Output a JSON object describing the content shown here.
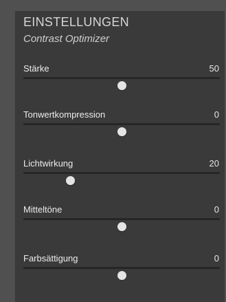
{
  "panel": {
    "title": "EINSTELLUNGEN",
    "subtitle": "Contrast Optimizer"
  },
  "sliders": [
    {
      "label": "Stärke",
      "value": "50",
      "position": 0.5
    },
    {
      "label": "Tonwertkompression",
      "value": "0",
      "position": 0.5
    },
    {
      "label": "Lichtwirkung",
      "value": "20",
      "position": 0.24
    },
    {
      "label": "Mitteltöne",
      "value": "0",
      "position": 0.5
    },
    {
      "label": "Farbsättigung",
      "value": "0",
      "position": 0.5
    }
  ]
}
